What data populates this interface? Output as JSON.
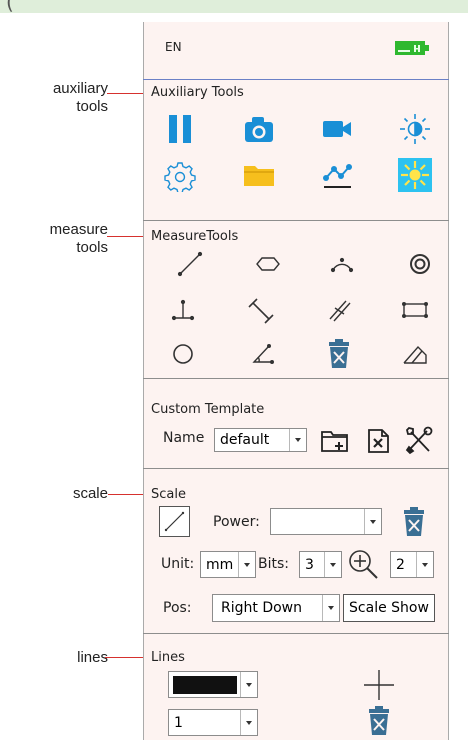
{
  "header": {
    "partial_text": "(",
    "language": "EN"
  },
  "callouts": {
    "auxiliary": "auxiliary\ntools",
    "measure": "measure\ntools",
    "scale": "scale",
    "lines": "lines"
  },
  "auxiliary_tools": {
    "title": "Auxiliary Tools",
    "icons": [
      "pause-icon",
      "camera-icon",
      "video-camera-icon",
      "brightness-icon",
      "settings-gear-icon",
      "folder-icon",
      "curve-nodes-icon",
      "light-toggle-icon"
    ]
  },
  "measure_tools": {
    "title": "MeasureTools",
    "icons": [
      "line-tool-icon",
      "polygon-tool-icon",
      "arc-tool-icon",
      "concentric-circle-icon",
      "perpendicular-tool-icon",
      "distance-tool-icon",
      "parallel-lines-icon",
      "rectangle-tool-icon",
      "circle-tool-icon",
      "angle-tool-icon",
      "delete-measure-icon",
      "polyline-tool-icon"
    ]
  },
  "custom_template": {
    "title": "Custom Template",
    "name_label": "Name",
    "name_value": "default"
  },
  "scale": {
    "title": "Scale",
    "power_label": "Power:",
    "power_value": "",
    "unit_label": "Unit:",
    "unit_value": "mm",
    "bits_label": "Bits:",
    "bits_value": "3",
    "zoom_value": "2",
    "pos_label": "Pos:",
    "pos_value": "Right Down",
    "show_button": "Scale Show"
  },
  "lines": {
    "title": "Lines",
    "width_value": "1"
  },
  "colors": {
    "blue_icon": "#1a8fd6",
    "folder": "#f6bf1d",
    "light_bg": "#2dc2f0",
    "light_fg": "#ffe44a",
    "separator_blue": "#6b80c6",
    "leader": "#d6312e"
  }
}
